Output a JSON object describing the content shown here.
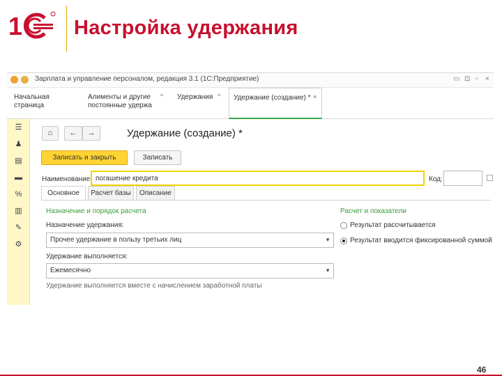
{
  "slide": {
    "title": "Настройка удержания",
    "page_number": "46"
  },
  "window": {
    "title_text": "Зарплата и управление персоналом, редакция 3.1 (1С:Предприятие)",
    "tabs": [
      {
        "label": "Начальная страница"
      },
      {
        "label": "Алименты и другие постоянные удержа"
      },
      {
        "label": "Удержания"
      },
      {
        "label": "Удержание (создание) *"
      }
    ]
  },
  "form": {
    "title": "Удержание (создание) *",
    "save_close_label": "Записать и закрыть",
    "save_label": "Записать",
    "name_label": "Наименование:",
    "name_value": "погашение кредита",
    "code_label": "Код:",
    "code_value": "",
    "tabs": [
      {
        "label": "Основное"
      },
      {
        "label": "Расчет базы"
      },
      {
        "label": "Описание"
      }
    ],
    "left_section": "Назначение и порядок расчета",
    "purpose_label": "Назначение удержания:",
    "purpose_value": "Прочее удержание в пользу третьих лиц",
    "frequency_label": "Удержание выполняется:",
    "frequency_value": "Ежемесячно",
    "hint_text": "Удержание выполняется вместе с начислением заработной платы",
    "right_section": "Расчет и показатели",
    "radio_options": [
      {
        "label": "Результат рассчитывается",
        "selected": false
      },
      {
        "label": "Результат вводится фиксированной суммой",
        "selected": true
      }
    ]
  },
  "colors": {
    "title_red": "#c8102e",
    "accent_yellow": "#ffd333",
    "sidebar_yellow": "#fff7c7",
    "green": "#3ea84a"
  }
}
